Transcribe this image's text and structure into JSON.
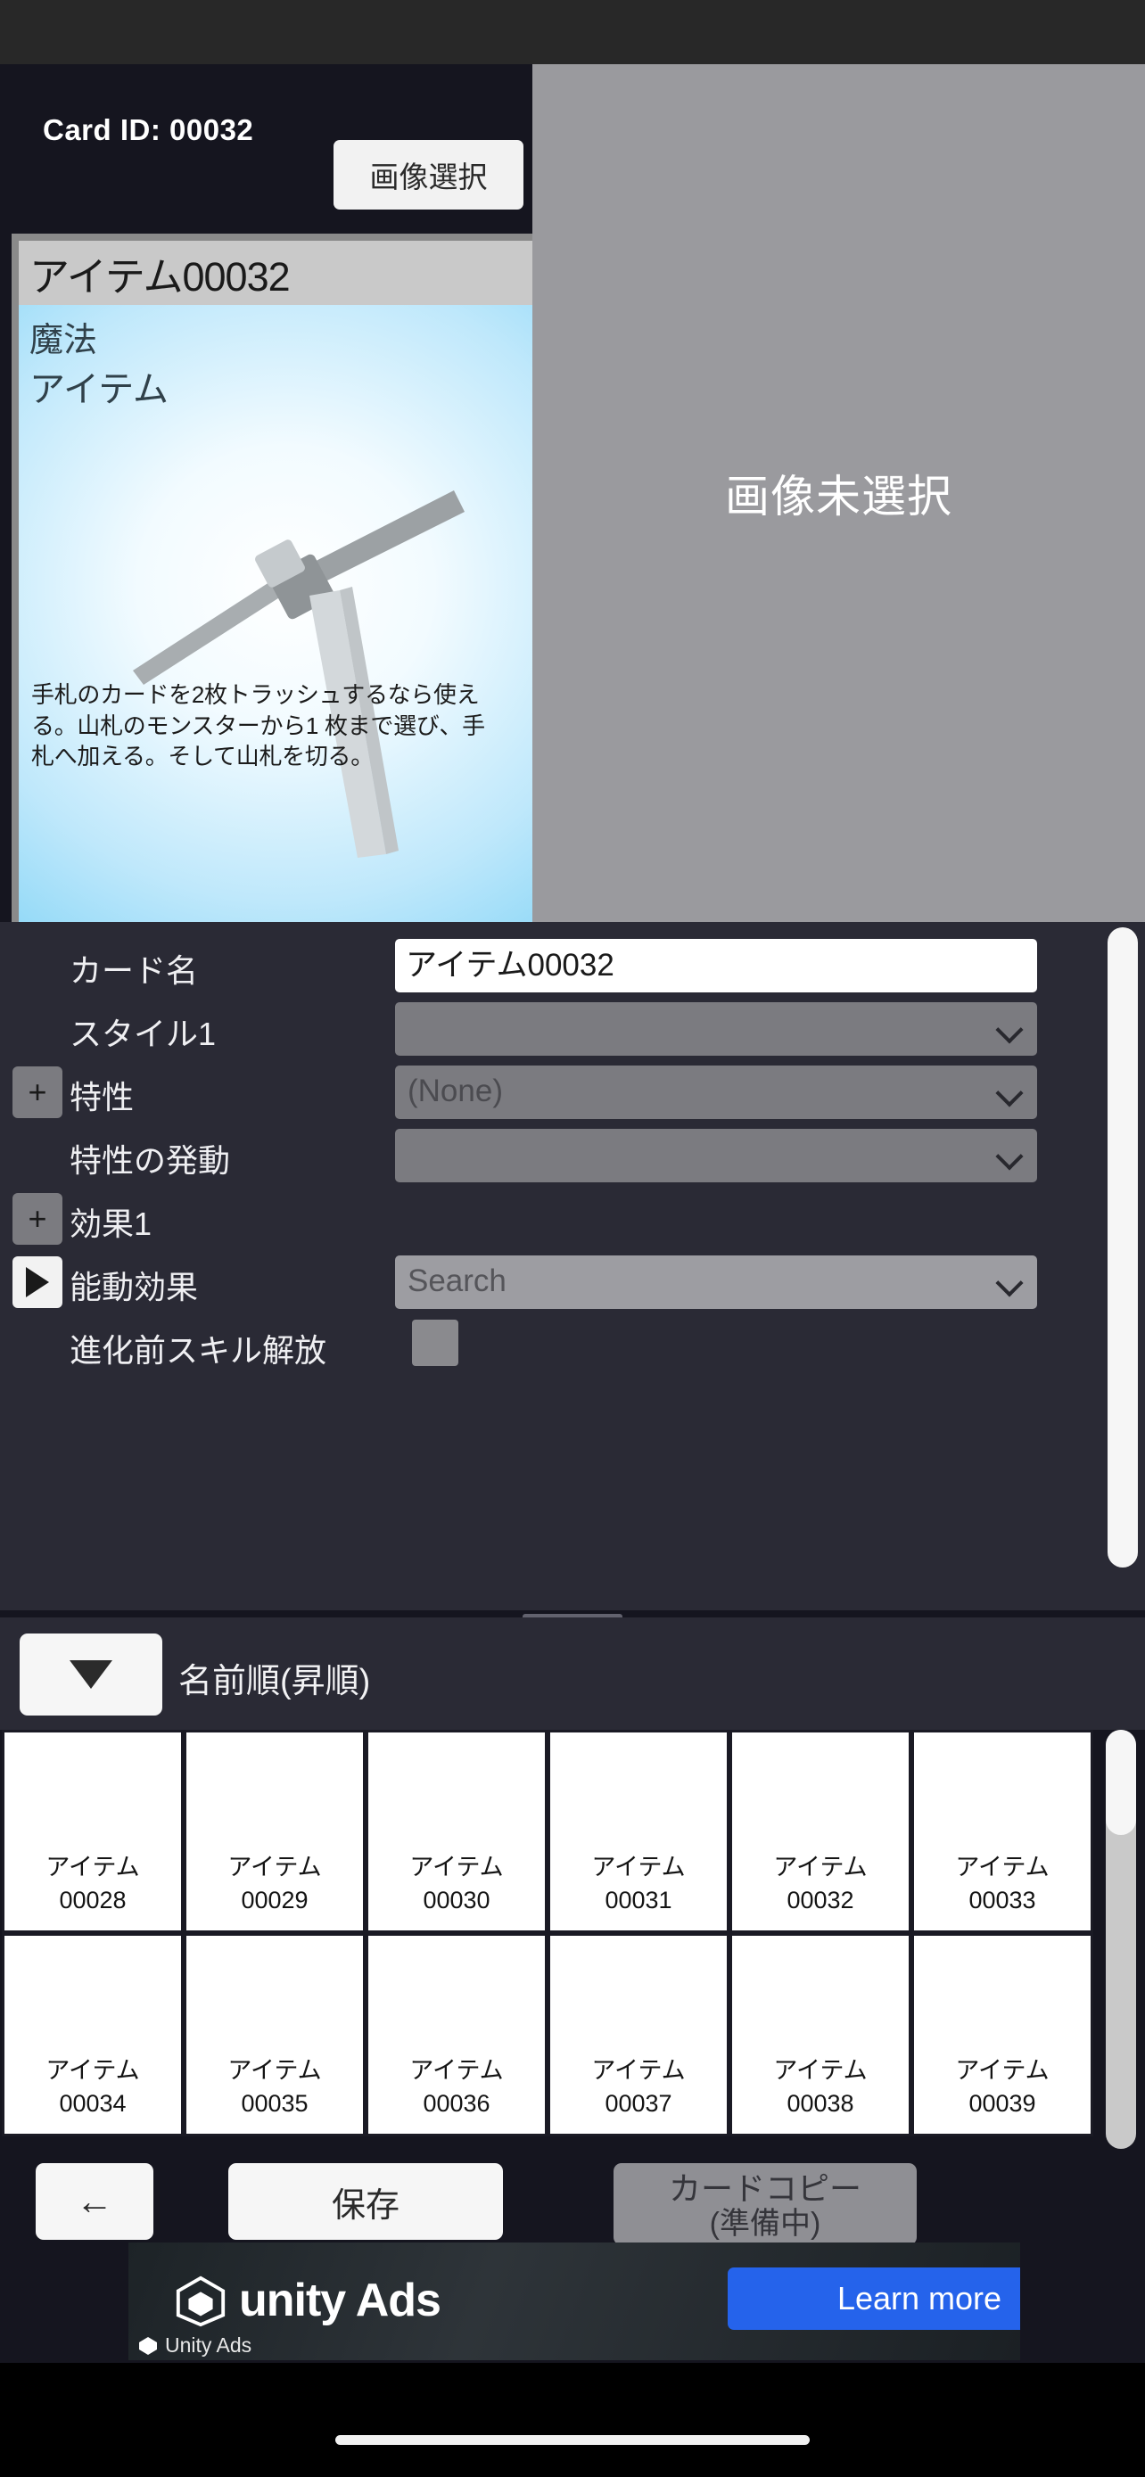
{
  "header": {
    "card_id_label": "Card ID: 00032",
    "select_image_button": "画像選択"
  },
  "card_preview": {
    "title": "アイテム00032",
    "type": "魔法",
    "subtype": "アイテム",
    "description": "手札のカードを2枚トラッシュするなら使える。山札のモンスターから1 枚まで選び、手札へ加える。そして山札を切る。",
    "art_icon": "pickaxe-icon"
  },
  "image_panel": {
    "placeholder_text": "画像未選択"
  },
  "form": {
    "rows": [
      {
        "label": "カード名",
        "control": "text",
        "value": "アイテム00032",
        "expander": null
      },
      {
        "label": "スタイル1",
        "control": "dropdown",
        "value": "",
        "expander": null
      },
      {
        "label": "特性",
        "control": "dropdown",
        "value": "(None)",
        "expander": "+"
      },
      {
        "label": "特性の発動",
        "control": "dropdown",
        "value": "",
        "expander": null
      },
      {
        "label": "効果1",
        "control": "none",
        "value": "",
        "expander": "+"
      },
      {
        "label": "能動効果",
        "control": "dropdown",
        "value": "Search",
        "expander": "play"
      },
      {
        "label": "進化前スキル解放",
        "control": "checkbox",
        "value": "",
        "expander": null
      }
    ]
  },
  "sort_bar": {
    "toggle_icon": "triangle-down-icon",
    "label": "名前順(昇順)"
  },
  "card_grid": {
    "items": [
      {
        "name": "アイテム",
        "id": "00028"
      },
      {
        "name": "アイテム",
        "id": "00029"
      },
      {
        "name": "アイテム",
        "id": "00030"
      },
      {
        "name": "アイテム",
        "id": "00031"
      },
      {
        "name": "アイテム",
        "id": "00032"
      },
      {
        "name": "アイテム",
        "id": "00033"
      },
      {
        "name": "アイテム",
        "id": "00034"
      },
      {
        "name": "アイテム",
        "id": "00035"
      },
      {
        "name": "アイテム",
        "id": "00036"
      },
      {
        "name": "アイテム",
        "id": "00037"
      },
      {
        "name": "アイテム",
        "id": "00038"
      },
      {
        "name": "アイテム",
        "id": "00039"
      }
    ]
  },
  "bottom_bar": {
    "back_label": "←",
    "save_label": "保存",
    "copy_label": "カードコピー",
    "copy_sublabel": "(準備中)"
  },
  "ad": {
    "brand": "unity Ads",
    "cta_label": "Learn more",
    "attribution": "Unity Ads"
  },
  "colors": {
    "panel_dark": "#2a2a35",
    "background": "#15151f",
    "accent_blue": "#2563eb",
    "field_grey": "#7b7b80",
    "card_blue": "#8fd8f7"
  }
}
